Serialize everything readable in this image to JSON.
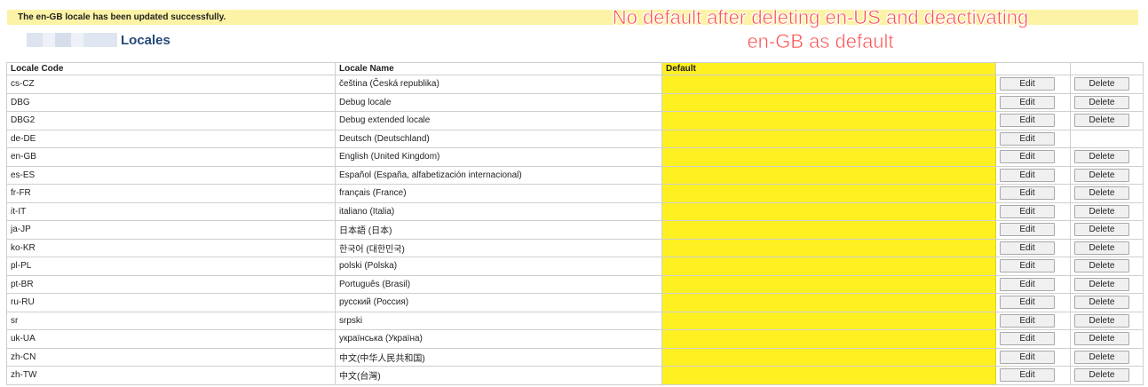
{
  "message": "The en-GB locale has been updated successfully.",
  "page_title": "Locales",
  "annotation": "No default after deleting en-US and deactivating en-GB as default",
  "colors": {
    "highlight": "#fff022",
    "title": "#254a7a",
    "annotation": "#ff4d4d",
    "message_bg": "#fdf3a6"
  },
  "table": {
    "headers": {
      "code": "Locale Code",
      "name": "Locale Name",
      "default": "Default"
    },
    "edit_label": "Edit",
    "delete_label": "Delete",
    "rows": [
      {
        "code": "cs-CZ",
        "name": "čeština (Česká republika)",
        "delete": true
      },
      {
        "code": "DBG",
        "name": "Debug locale",
        "delete": true
      },
      {
        "code": "DBG2",
        "name": "Debug extended locale",
        "delete": true
      },
      {
        "code": "de-DE",
        "name": "Deutsch (Deutschland)",
        "delete": false
      },
      {
        "code": "en-GB",
        "name": "English (United Kingdom)",
        "delete": true
      },
      {
        "code": "es-ES",
        "name": "Español (España, alfabetización internacional)",
        "delete": true
      },
      {
        "code": "fr-FR",
        "name": "français (France)",
        "delete": true
      },
      {
        "code": "it-IT",
        "name": "italiano (Italia)",
        "delete": true
      },
      {
        "code": "ja-JP",
        "name": "日本語 (日本)",
        "delete": true
      },
      {
        "code": "ko-KR",
        "name": "한국어 (대한민국)",
        "delete": true
      },
      {
        "code": "pl-PL",
        "name": "polski (Polska)",
        "delete": true
      },
      {
        "code": "pt-BR",
        "name": "Português (Brasil)",
        "delete": true
      },
      {
        "code": "ru-RU",
        "name": "русский (Россия)",
        "delete": true
      },
      {
        "code": "sr",
        "name": "srpski",
        "delete": true
      },
      {
        "code": "uk-UA",
        "name": "українська (Україна)",
        "delete": true
      },
      {
        "code": "zh-CN",
        "name": "中文(中华人民共和国)",
        "delete": true
      },
      {
        "code": "zh-TW",
        "name": "中文(台灣)",
        "delete": true
      }
    ]
  }
}
